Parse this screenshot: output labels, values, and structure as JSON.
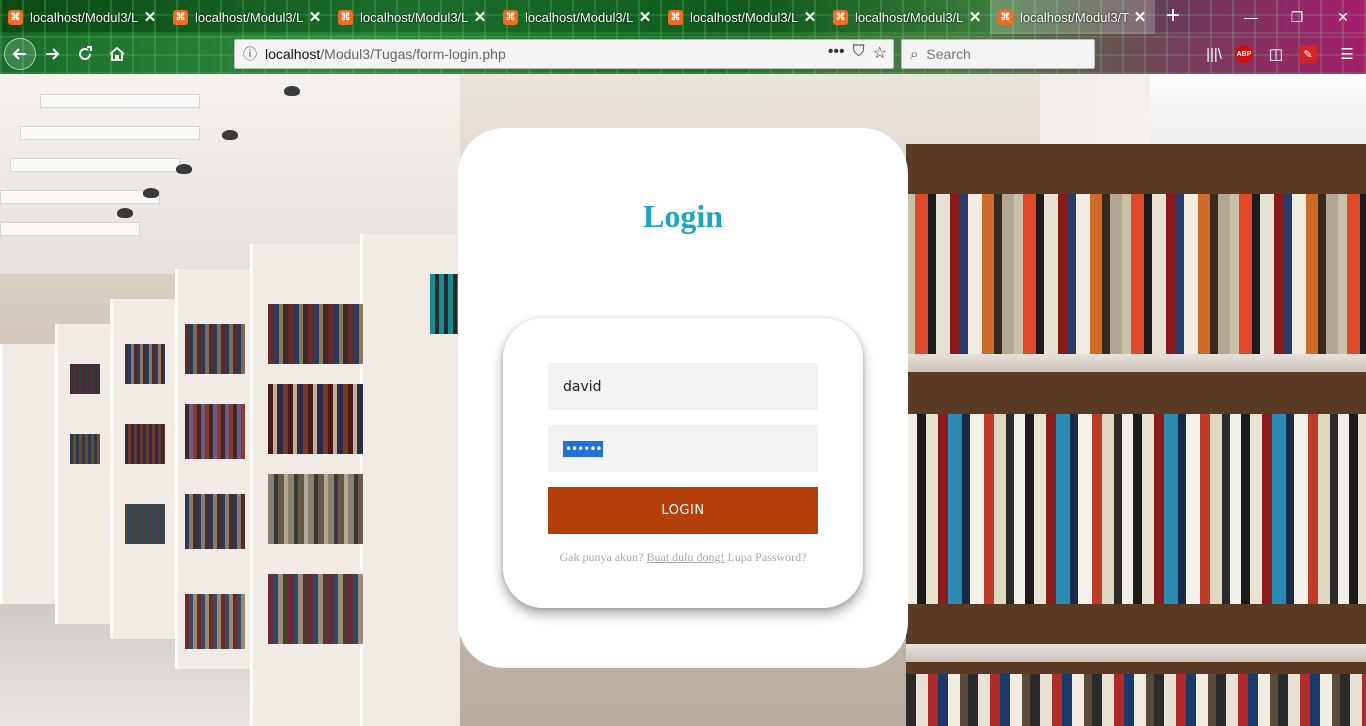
{
  "browser": {
    "tabs": [
      {
        "title": "localhost/Modul3/L",
        "active": false
      },
      {
        "title": "localhost/Modul3/L",
        "active": false
      },
      {
        "title": "localhost/Modul3/L",
        "active": false
      },
      {
        "title": "localhost/Modul3/L",
        "active": false
      },
      {
        "title": "localhost/Modul3/L",
        "active": false
      },
      {
        "title": "localhost/Modul3/L",
        "active": false
      },
      {
        "title": "localhost/Modul3/T",
        "active": true
      }
    ],
    "tab_close_glyph": "✕",
    "new_tab_glyph": "+",
    "window_controls": {
      "minimize": "—",
      "restore": "❐",
      "close": "✕"
    },
    "url": {
      "host": "localhost",
      "path": "/Modul3/Tugas/form-login.php"
    },
    "url_actions": {
      "more": "•••",
      "pocket": "⛉",
      "bookmark": "☆"
    },
    "search_placeholder": "Search",
    "toolbar": {
      "library": "|||\\",
      "abp": "ABP",
      "sidebar": "◫",
      "menu": "☰"
    }
  },
  "page": {
    "title": "Login",
    "username_value": "david",
    "password_masked": "••••••",
    "login_button": "LOGIN",
    "message_prefix": "Gak punya akun? ",
    "message_link": "Buat dulu dong!",
    "message_suffix": " Lupa Password?"
  },
  "colors": {
    "title": "#1ba5c4",
    "button": "#b43f0a",
    "input_bg": "#f2f2f2",
    "message": "#a8a8a8"
  }
}
